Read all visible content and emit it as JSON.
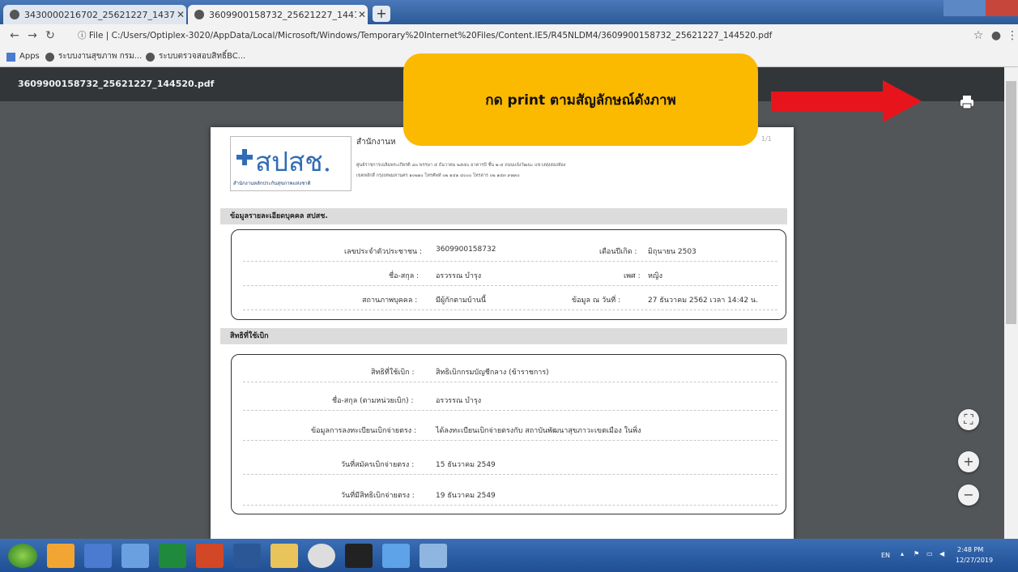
{
  "browser": {
    "tabs": [
      {
        "label": "3430000216702_25621227_1437"
      },
      {
        "label": "3609900158732_25621227_1441"
      }
    ],
    "address": {
      "prefix": "File",
      "url": "C:/Users/Optiplex-3020/AppData/Local/Microsoft/Windows/Temporary%20Internet%20Files/Content.IE5/R45NLDM4/3609900158732_25621227_144520.pdf"
    },
    "bookmarks": [
      {
        "label": "Apps"
      },
      {
        "label": "ระบบงานสุขภาพ กรม..."
      },
      {
        "label": "ระบบตรวจสอบสิทธิ์BC..."
      }
    ]
  },
  "pdf": {
    "filename": "3609900158732_25621227_144520.pdf",
    "page_indicator": "1/1",
    "logo_text": "สปสช.",
    "logo_sub": "สำนักงานหลักประกันสุขภาพแห่งชาติ",
    "org_name": "สำนักงานห",
    "org_line1": "ศูนย์ราชการเฉลิมพระเกียรติ ๘๐ พรรษา ๕ ธันวาคม ๒๕๕๐ อาคารบี ชั้น ๒-๔ ถนนแจ้งวัฒนะ แขวงทุ่งสองห้อง",
    "org_line2": "เขตหลักสี่ กรุงเทพมหานคร ๑๐๒๑๐ โทรศัพท์ ๐๒ ๑๔๑ ๔๐๐๐ โทรสาร ๐๒ ๑๔๓ ๙๗๓๐",
    "section1": {
      "title": "ข้อมูลรายละเอียดบุคคล สปสช.",
      "id_label": "เลขประจำตัวประชาชน :",
      "id_value": "3609900158732",
      "birth_label": "เดือนปีเกิด :",
      "birth_value": "มิถุนายน 2503",
      "name_label": "ชื่อ-สกุล :",
      "name_value": "อรวรรณ บำรุง",
      "sex_label": "เพศ :",
      "sex_value": "หญิง",
      "status_label": "สถานภาพบุคคล :",
      "status_value": "มีผู้กักตามบ้านนี้",
      "date_label": "ข้อมูล ณ วันที่ :",
      "date_value": "27 ธันวาคม 2562 เวลา 14:42 น."
    },
    "section2": {
      "title": "สิทธิที่ใช้เบิก",
      "right_label": "สิทธิที่ใช้เบิก :",
      "right_value": "สิทธิเบิกกรมบัญชีกลาง (ข้าราชการ)",
      "name_label": "ชื่อ-สกุล (ตามหน่วยเบิก) :",
      "name_value": "อรวรรณ บำรุง",
      "reg_label": "ข้อมูลการลงทะเบียนเบิกจ่ายตรง :",
      "reg_value": "ได้ลงทะเบียนเบิกจ่ายตรงกับ สถาบันพัฒนาสุขภาวะเขตเมือง ในพิ่ง",
      "start_label": "วันที่สมัครเบิกจ่ายตรง :",
      "start_value": "15 ธันวาคม 2549",
      "eff_label": "วันที่มีสิทธิเบิกจ่ายตรง :",
      "eff_value": "19 ธันวาคม 2549"
    }
  },
  "callout": {
    "text": "กด print ตามสัญลักษณ์ดังภาพ"
  },
  "tray": {
    "lang": "EN",
    "time": "2:48 PM",
    "date": "12/27/2019"
  },
  "colors": {
    "callout": "#fbb900",
    "arrow": "#e8141c",
    "logo_blue": "#2f6db5"
  }
}
